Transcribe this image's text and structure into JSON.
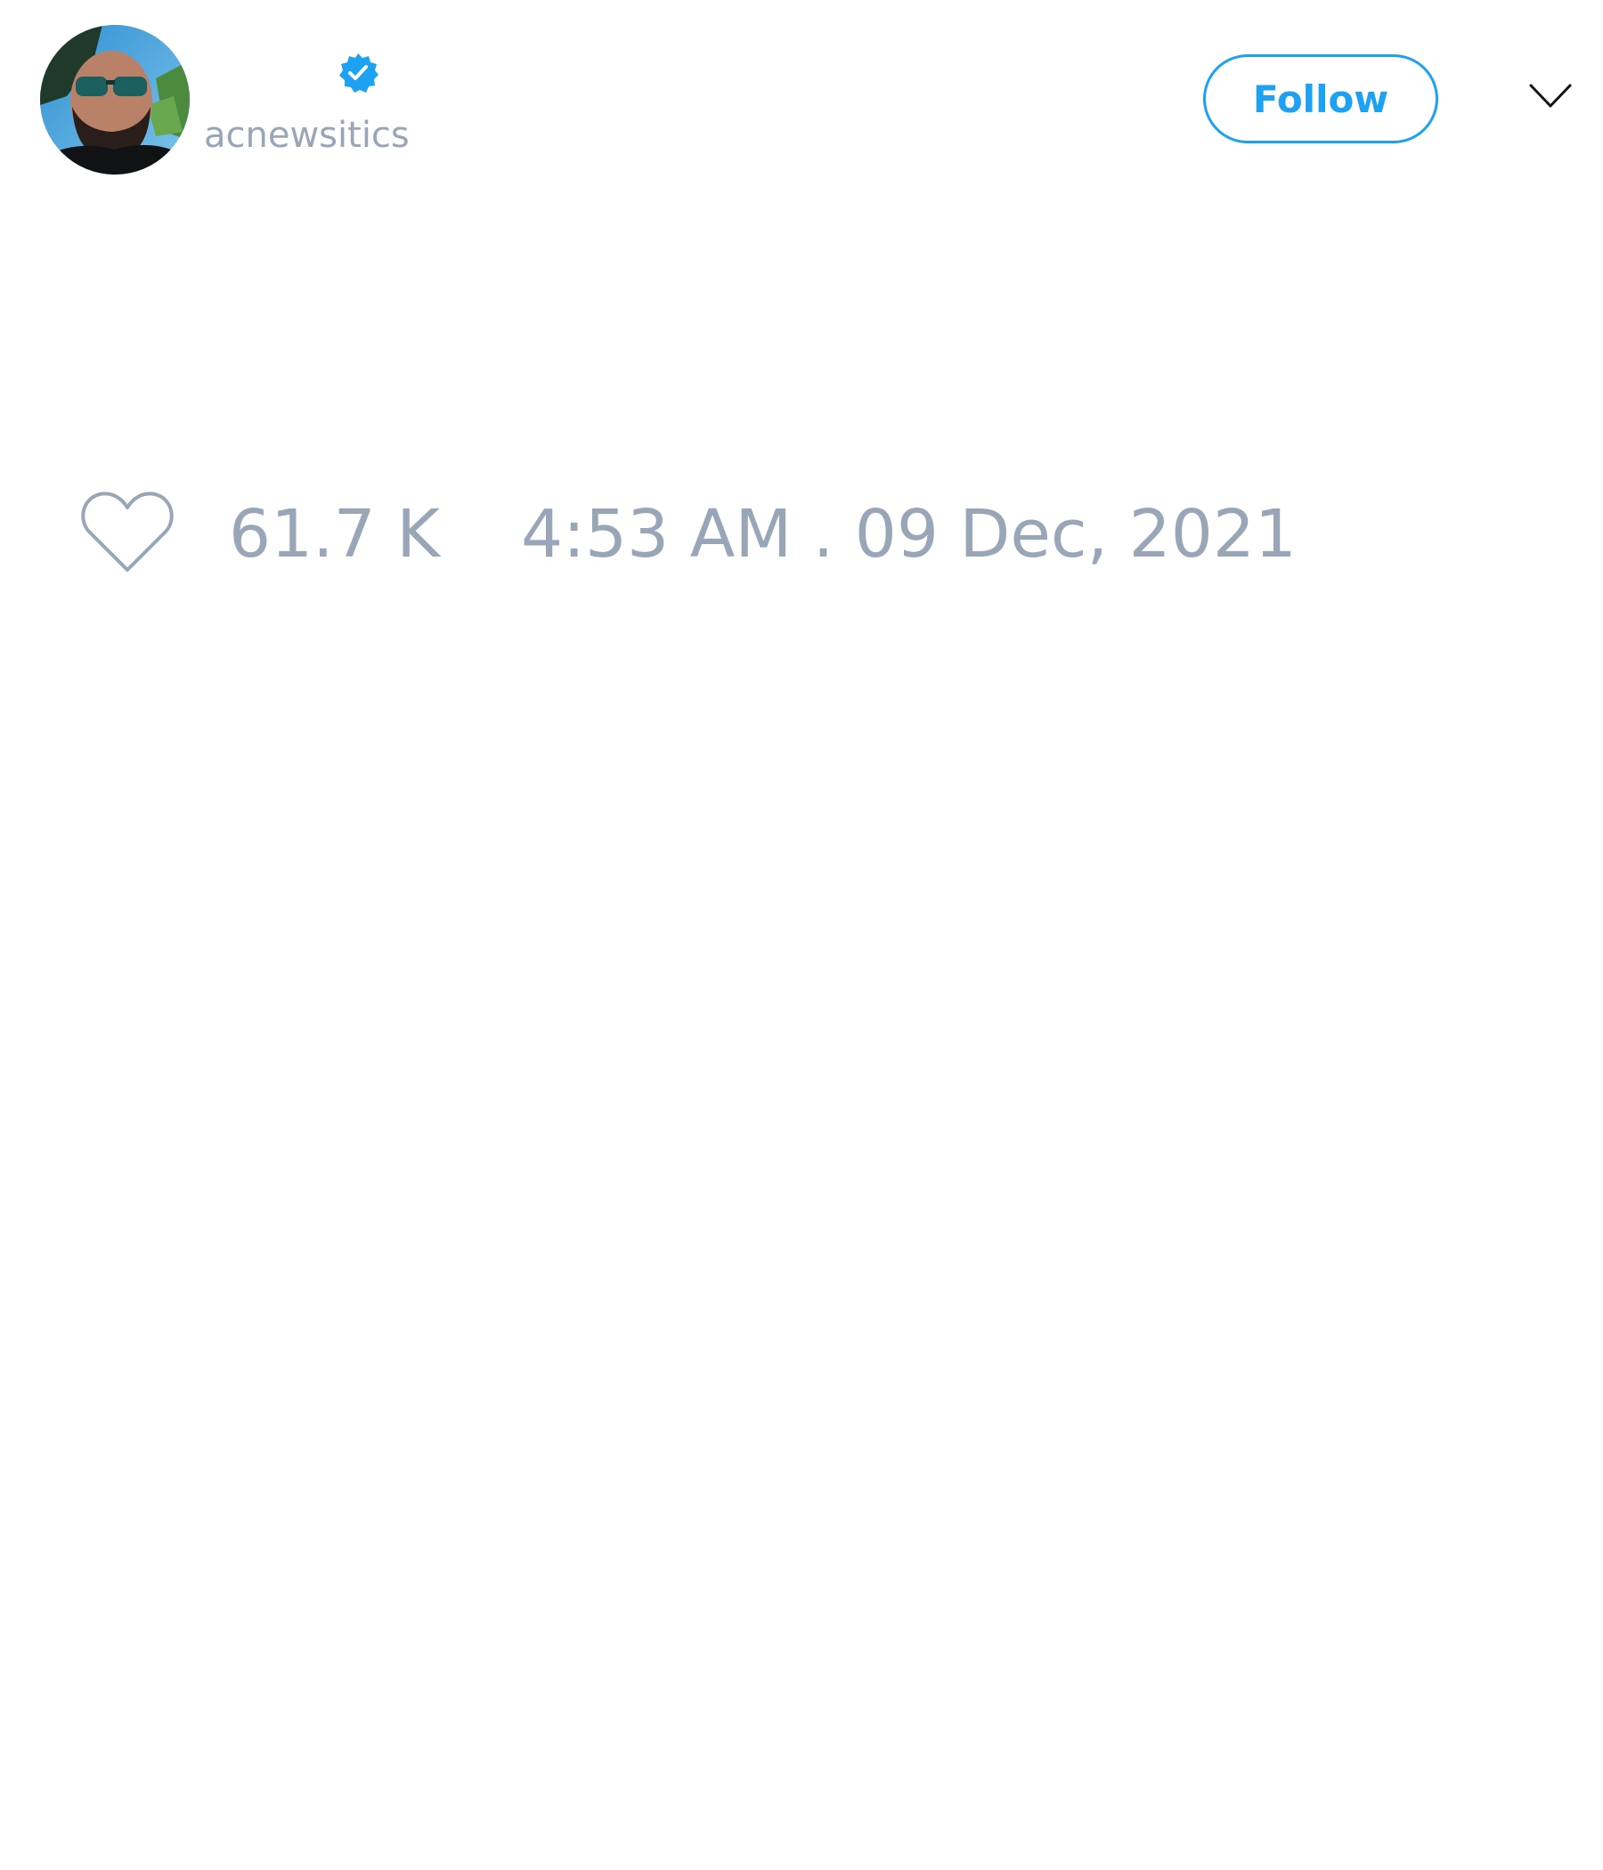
{
  "tweet": {
    "author": {
      "display_name": "",
      "handle": "acnewsitics",
      "verified": true,
      "avatar": "profile-photo"
    },
    "follow_label": "Follow",
    "menu_icon": "chevron-down-icon",
    "like_icon": "heart-outline-icon",
    "likes": "61.7 K",
    "timestamp": "4:53 AM . 09 Dec, 2021"
  },
  "colors": {
    "accent": "#1da1f2",
    "muted_text": "#98a6b8",
    "background": "#ffffff"
  }
}
